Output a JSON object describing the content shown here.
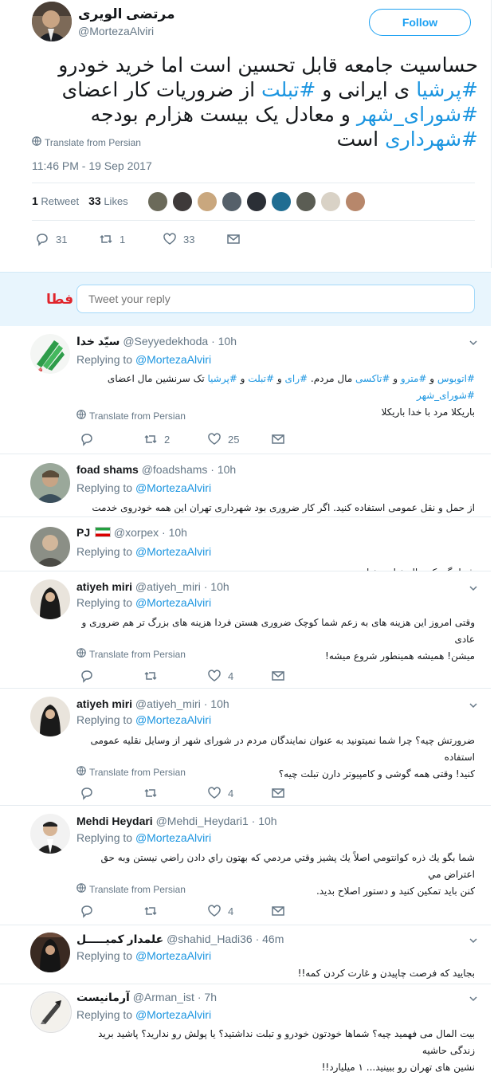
{
  "main_tweet": {
    "display_name": "مرتضی الویری",
    "handle": "@MortezaAlviri",
    "follow_label": "Follow",
    "text_parts": [
      {
        "t": "حساسیت جامعه قابل تحسین است اما خرید خودرو ",
        "tag": false
      },
      {
        "t": "#پرشیا",
        "tag": true
      },
      {
        "t": " ی ایرانی و ",
        "tag": false
      },
      {
        "t": "#تبلت",
        "tag": true
      },
      {
        "t": " از ضروریات کار اعضای ",
        "tag": false
      },
      {
        "t": "#شورای_شهر",
        "tag": true
      },
      {
        "t": " و معادل یک بیست هزارم بودجه ",
        "tag": false
      },
      {
        "t": "#شهرداری",
        "tag": true
      },
      {
        "t": " است",
        "tag": false
      }
    ],
    "translate_label": "Translate from Persian",
    "timestamp": "11:46 PM - 19 Sep 2017",
    "retweets_count": "1",
    "retweets_label": "Retweet",
    "likes_count": "33",
    "likes_label": "Likes",
    "liker_colors": [
      "#6b6a5a",
      "#3e3a3a",
      "#c9a77e",
      "#55606a",
      "#2b2f36",
      "#1f6d92",
      "#5b5d54",
      "#d9d2c6",
      "#b7876b"
    ],
    "actions": {
      "replies": "31",
      "retweets": "1",
      "likes": "33"
    }
  },
  "reply_box": {
    "logo_text": "فطا",
    "placeholder": "Tweet your reply"
  },
  "replying_label": "Replying to",
  "replying_handle": "@MortezaAlviri",
  "replies": [
    {
      "name": "سیّد خدا",
      "handle": "@Seyyedekhoda",
      "time": "10h",
      "text_line1": "#اتوبوس و #مترو و #تاکسی مال مردم. #رای و #تبلت و #پرشیا تک سرنشین مال اعضای #شورای_شهر",
      "text_line2": "باریکلا مرد با خدا باریکلا",
      "translate": "Translate from Persian",
      "replies": "",
      "retweets": "2",
      "likes": "25"
    },
    {
      "name": "foad shams",
      "handle": "@foadshams",
      "time": "10h",
      "text_line1": "از حمل و نقل عمومی استفاده کنید. اگر کار ضروری بود شهرداری تهران این همه خودروی خدمت دارد"
    },
    {
      "name": "PJ",
      "handle": "@xorpex",
      "time": "10h",
      "text_line1": "شما بگو یک ریال خیانت خیانته"
    },
    {
      "name": "atiyeh miri",
      "handle": "@atiyeh_miri",
      "time": "10h",
      "text_line1": "وقتی امروز این هزینه های به زعم شما کوچک ضروری هستن فردا هزینه های بزرگ تر هم ضروری و عادی",
      "text_line2": "میشن! همیشه همینطور شروع میشه!",
      "translate": "Translate from Persian",
      "replies": "",
      "retweets": "",
      "likes": "4"
    },
    {
      "name": "atiyeh miri",
      "handle": "@atiyeh_miri",
      "time": "10h",
      "text_line1": "ضرورتش چیه؟ چرا شما نمیتونید به عنوان نمایندگان مردم در شورای شهر از وسایل نقلیه عمومی استفاده",
      "text_line2": "کنید! وقتی همه گوشی و کامپیوتر دارن تبلت چیه؟",
      "translate": "Translate from Persian",
      "replies": "",
      "retweets": "",
      "likes": "4"
    },
    {
      "name": "Mehdi Heydari",
      "handle": "@Mehdi_Heydari1",
      "time": "10h",
      "text_line1": "شما بگو یك ذره كوانتومي اصلاً یك پشيز وقتي مردمي كه بهتون راي دادن راضي نيستن وبه حق اعتراض مي",
      "text_line2": "كنن بايد تمكين كنيد و دستور اصلاح بديد.",
      "translate": "Translate from Persian",
      "replies": "",
      "retweets": "",
      "likes": "4"
    },
    {
      "name": "علمدار کمیـــــل",
      "handle": "@shahid_Hadi36",
      "time": "46m",
      "text_line1": "بجایید که فرصت چاپیدن و غارت کردن کمه!!"
    },
    {
      "name": "آرمانیست",
      "handle": "@Arman_ist",
      "time": "7h",
      "text_line1": "بیت المال می فهمید چیه؟ شماها خودتون خودرو و تبلت نداشتید؟ یا پولش رو ندارید؟ پاشید برید زندگی حاشیه",
      "text_line2": "نشین های تهران رو ببینید... ۱ میلیارد!!"
    }
  ]
}
